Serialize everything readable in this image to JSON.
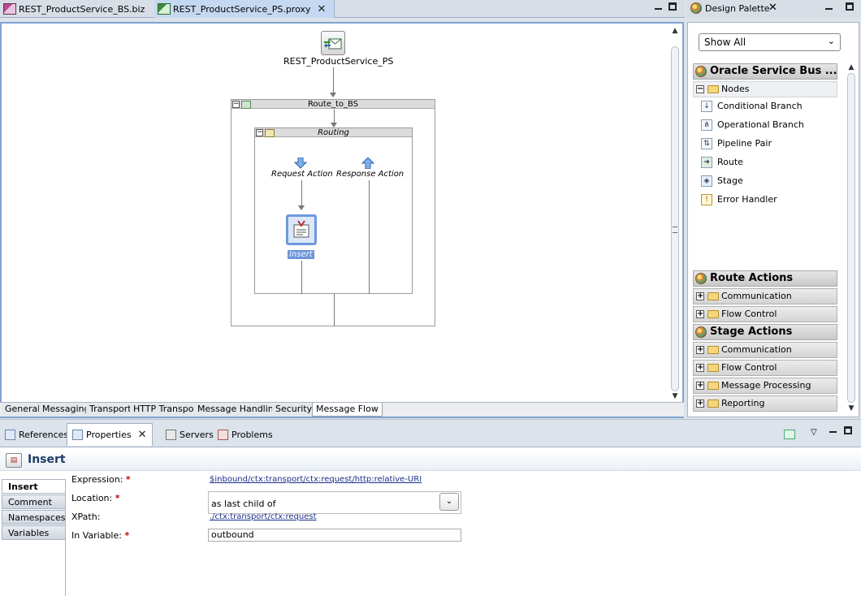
{
  "editor_tabs": [
    {
      "label": "REST_ProductService_BS.biz",
      "active": false
    },
    {
      "label": "REST_ProductService_PS.proxy",
      "active": true
    }
  ],
  "flow": {
    "proxy_label": "REST_ProductService_PS",
    "route_node_label": "Route_to_BS",
    "routing_label": "Routing",
    "request_action_label": "Request Action",
    "response_action_label": "Response Action",
    "insert_action_label": "Insert"
  },
  "editor_bottom_tabs": [
    "General",
    "Messaging",
    "Transport",
    "HTTP Transport",
    "Message Handling",
    "Security",
    "Message Flow"
  ],
  "editor_bottom_selected": "Message Flow",
  "palette": {
    "title": "Design Palette",
    "filter_value": "Show All",
    "section_osb": "Oracle Service Bus ...",
    "nodes_group": "Nodes",
    "node_items": [
      "Conditional Branch",
      "Operational Branch",
      "Pipeline Pair",
      "Route",
      "Stage",
      "Error Handler"
    ],
    "section_route": "Route Actions",
    "route_groups": [
      "Communication",
      "Flow Control"
    ],
    "section_stage": "Stage Actions",
    "stage_groups": [
      "Communication",
      "Flow Control",
      "Message Processing",
      "Reporting"
    ]
  },
  "view_tabs": [
    {
      "label": "References",
      "active": false
    },
    {
      "label": "Properties",
      "active": true
    },
    {
      "label": "Servers",
      "active": false
    },
    {
      "label": "Problems",
      "active": false
    }
  ],
  "properties": {
    "title": "Insert",
    "side_tabs": [
      "Insert",
      "Comment",
      "Namespaces",
      "Variables"
    ],
    "expression_label": "Expression:",
    "expression_value": "$inbound/ctx:transport/ctx:request/http:relative-URI",
    "location_label": "Location:",
    "location_value": "as last child of",
    "xpath_label": "XPath:",
    "xpath_value": "./ctx:transport/ctx:request",
    "invariable_label": "In Variable:",
    "invariable_value": "outbound",
    "required_mark": "*"
  }
}
